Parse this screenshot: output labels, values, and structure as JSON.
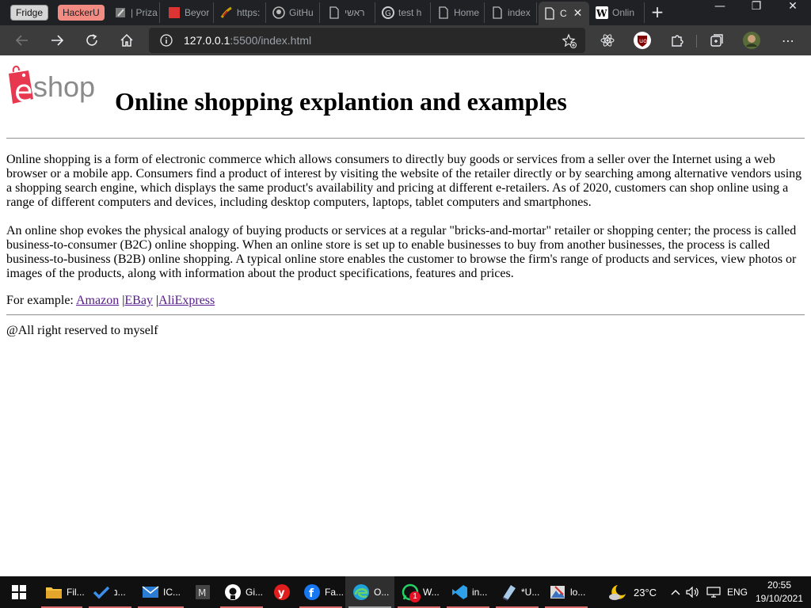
{
  "browser": {
    "tab_groups": [
      {
        "label": "Fridge",
        "color": "#d5d5d5"
      },
      {
        "label": "HackerU",
        "color": "#f28b82"
      }
    ],
    "tabs": [
      {
        "label": "| Priza",
        "icon": "dark-square-icon"
      },
      {
        "label": "Beyor",
        "icon": "beyond-icon"
      },
      {
        "label": "https:",
        "icon": "feather-icon"
      },
      {
        "label": "GitHu",
        "icon": "github-icon"
      },
      {
        "label": "ראשי",
        "icon": "page-icon"
      },
      {
        "label": "test h",
        "icon": "google-icon"
      },
      {
        "label": "Home",
        "icon": "page-icon"
      },
      {
        "label": "index",
        "icon": "page-icon"
      },
      {
        "label": "C",
        "icon": "page-icon",
        "active": true
      },
      {
        "label": "Onlin",
        "icon": "wikipedia-icon"
      }
    ],
    "address": {
      "host": "127.0.0.1",
      "path": ":5500/index.html"
    }
  },
  "page": {
    "logo_text": "shop",
    "logo_letter": "e",
    "title": "Online shopping explantion and examples",
    "paragraph1": "Online shopping is a form of electronic commerce which allows consumers to directly buy goods or services from a seller over the Internet using a web browser or a mobile app. Consumers find a product of interest by visiting the website of the retailer directly or by searching among alternative vendors using a shopping search engine, which displays the same product's availability and pricing at different e-retailers. As of 2020, customers can shop online using a range of different computers and devices, including desktop computers, laptops, tablet computers and smartphones.",
    "paragraph2": "An online shop evokes the physical analogy of buying products or services at a regular \"bricks-and-mortar\" retailer or shopping center; the process is called business-to-consumer (B2C) online shopping. When an online store is set up to enable businesses to buy from another businesses, the process is called business-to-business (B2B) online shopping. A typical online store enables the customer to browse the firm's range of products and services, view photos or images of the products, along with information about the product specifications, features and prices.",
    "examples_prefix": "For example: ",
    "links": [
      "Amazon",
      "EBay",
      "AliExpress"
    ],
    "link_separator": " |",
    "footer": "@All right reserved to myself"
  },
  "taskbar": {
    "items": [
      {
        "label": "Fil...",
        "icon": "file-explorer-icon"
      },
      {
        "label": "נ...",
        "icon": "todo-check-icon"
      },
      {
        "label": "IC...",
        "icon": "mail-icon"
      },
      {
        "label": "",
        "icon": "m-app-icon"
      },
      {
        "label": "Gi...",
        "icon": "github-icon"
      },
      {
        "label": "",
        "icon": "ynet-icon"
      },
      {
        "label": "Fa...",
        "icon": "facebook-icon"
      },
      {
        "label": "O...",
        "icon": "edge-icon",
        "active": true
      },
      {
        "label": "W...",
        "icon": "whatsapp-icon",
        "badge": "1"
      },
      {
        "label": "in...",
        "icon": "vscode-icon"
      },
      {
        "label": "*U...",
        "icon": "notepad-icon"
      },
      {
        "label": "lo...",
        "icon": "image-viewer-icon"
      }
    ],
    "weather": "23°C",
    "language": "ENG",
    "time": "20:55",
    "date": "19/10/2021"
  },
  "colors": {
    "chrome_dark": "#202124",
    "toolbar": "#3c3c3c",
    "link_visited": "#551a8b",
    "logo_red": "#e8384f",
    "logo_gray": "#8a8a8a"
  }
}
